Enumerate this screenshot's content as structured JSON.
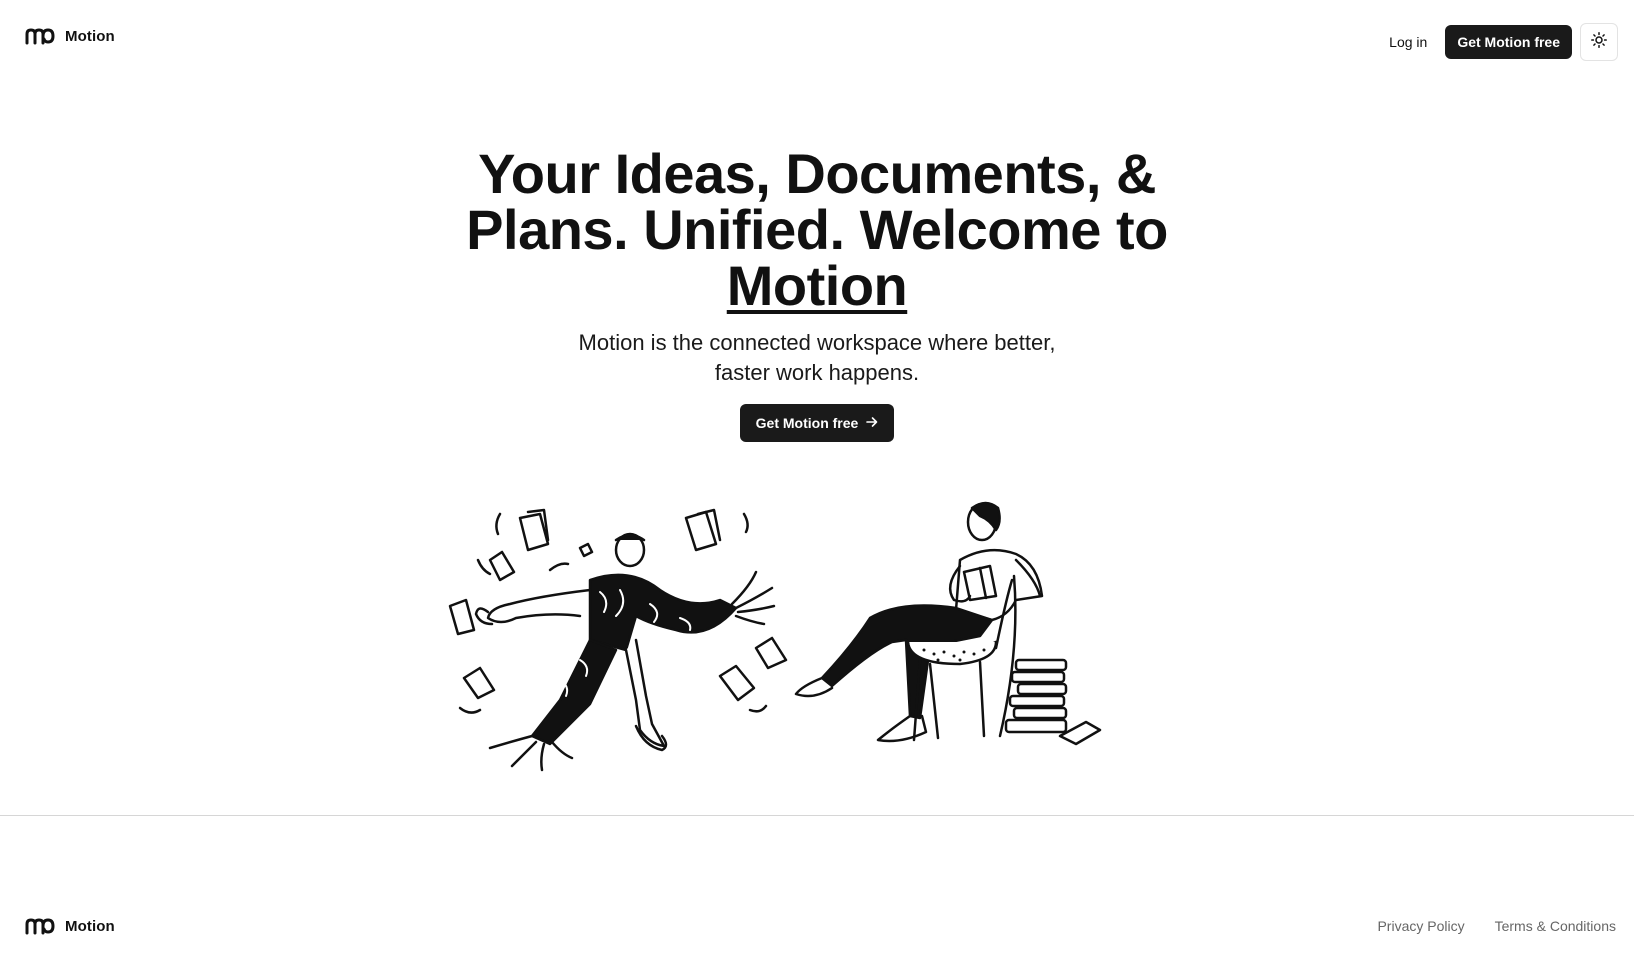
{
  "nav": {
    "brand_name": "Motion",
    "login_label": "Log in",
    "cta_label": "Get Motion free",
    "theme_icon": "sun-icon"
  },
  "hero": {
    "headline_prefix": "Your Ideas, Documents, & Plans. Unified. Welcome to ",
    "headline_link": "Motion",
    "subheadline": "Motion is the connected workspace where better, faster work happens.",
    "cta_label": "Get Motion free",
    "cta_icon": "arrow-right-icon"
  },
  "illustration": {
    "left_figure": "person-running-with-papers",
    "right_figure": "person-reading-in-chair"
  },
  "footer": {
    "brand_name": "Motion",
    "links": [
      "Privacy Policy",
      "Terms & Conditions"
    ]
  },
  "colors": {
    "background": "#ffffff",
    "text": "#111111",
    "button_dark": "#1a1a1a",
    "muted": "#666666",
    "divider": "#d6d6d6"
  }
}
